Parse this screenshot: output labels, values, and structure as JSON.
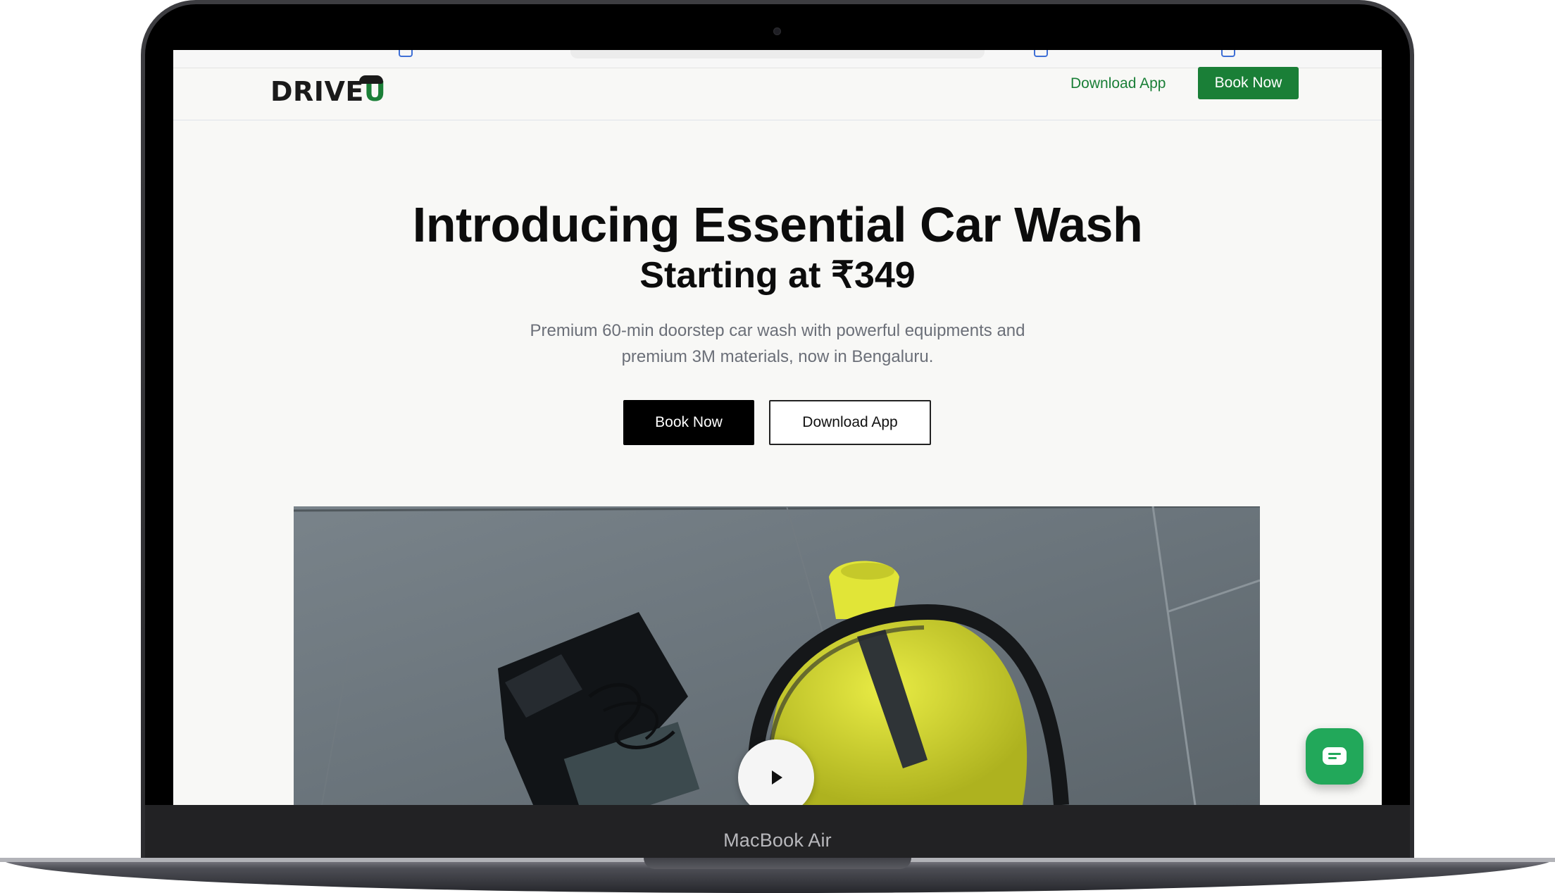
{
  "device": {
    "model_label": "MacBook Air"
  },
  "header": {
    "logo_text": "DRIVE",
    "logo_accent": "U",
    "download_label": "Download App",
    "book_label": "Book Now"
  },
  "hero": {
    "title": "Introducing Essential Car Wash",
    "subtitle": "Starting at ₹349",
    "description_line1": "Premium 60-min doorstep car wash with powerful equipments and",
    "description_line2": "premium 3M materials, now in Bengaluru.",
    "book_label": "Book Now",
    "download_label": "Download App"
  },
  "video": {
    "play_icon": "play-icon"
  },
  "chat": {
    "icon": "chat-icon"
  },
  "colors": {
    "brand_green": "#1a7f37",
    "chat_green": "#22a85a",
    "text_dark": "#0c0c0c",
    "text_muted": "#6b6f78",
    "page_bg": "#f8f8f6"
  }
}
